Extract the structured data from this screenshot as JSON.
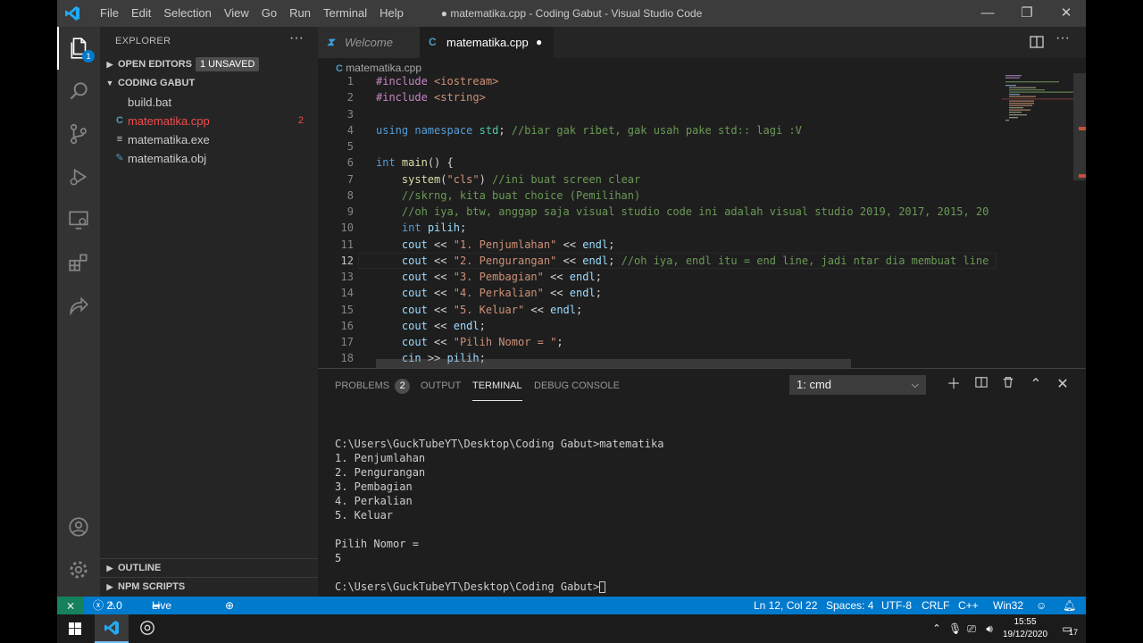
{
  "titlebar": {
    "menu": [
      "File",
      "Edit",
      "Selection",
      "View",
      "Go",
      "Run",
      "Terminal",
      "Help"
    ],
    "title": "● matematika.cpp - Coding Gabut - Visual Studio Code"
  },
  "activity": {
    "explorer_badge": "1"
  },
  "sidebar": {
    "title": "EXPLORER",
    "open_editors": "OPEN EDITORS",
    "unsaved": "1 UNSAVED",
    "folder": "CODING GABUT",
    "files": [
      {
        "icon": "build-file-icon",
        "name": "build.bat",
        "count": ""
      },
      {
        "icon": "cpp-file-icon",
        "name": "matematika.cpp",
        "count": "2"
      },
      {
        "icon": "exe-file-icon",
        "name": "matematika.exe",
        "count": ""
      },
      {
        "icon": "obj-file-icon",
        "name": "matematika.obj",
        "count": ""
      }
    ],
    "outline": "OUTLINE",
    "npm": "NPM SCRIPTS"
  },
  "editor": {
    "tabs": [
      {
        "label": "Welcome",
        "active": false
      },
      {
        "label": "matematika.cpp",
        "active": true
      }
    ],
    "breadcrumb": "matematika.cpp",
    "line_numbers": [
      "1",
      "2",
      "3",
      "4",
      "5",
      "6",
      "7",
      "8",
      "9",
      "10",
      "11",
      "12",
      "13",
      "14",
      "15",
      "16",
      "17",
      "18"
    ],
    "lines": [
      "#include <iostream>",
      "#include <string>",
      "",
      "using namespace std; //biar gak ribet, gak usah pake std:: lagi :V",
      "",
      "int main() {",
      "    system(\"cls\") //ini buat screen clear",
      "    //skrng, kita buat choice (Pemilihan)",
      "    //oh iya, btw, anggap saja visual studio code ini adalah visual studio 2019, 2017, 2015, 20",
      "    int pilih;",
      "    cout << \"1. Penjumlahan\" << endl;",
      "    cout << \"2. Pengurangan\" << endl; //oh iya, endl itu = end line, jadi ntar dia membuat line",
      "    cout << \"3. Pembagian\" << endl;",
      "    cout << \"4. Perkalian\" << endl;",
      "    cout << \"5. Keluar\" << endl;",
      "    cout << endl;",
      "    cout << \"Pilih Nomor = \";",
      "    cin >> pilih;"
    ]
  },
  "panel": {
    "tabs": [
      "PROBLEMS",
      "OUTPUT",
      "TERMINAL",
      "DEBUG CONSOLE"
    ],
    "problems_count": "2",
    "active_tab": "TERMINAL",
    "terminal_select": "1: cmd",
    "terminal_lines": [
      "C:\\Users\\GuckTubeYT\\Desktop\\Coding Gabut>matematika",
      "1. Penjumlahan",
      "2. Pengurangan",
      "3. Pembagian",
      "4. Perkalian",
      "5. Keluar",
      "",
      "Pilih Nomor =",
      "5",
      "",
      "C:\\Users\\GuckTubeYT\\Desktop\\Coding Gabut>"
    ]
  },
  "statusbar": {
    "errors": "2",
    "warnings": "0",
    "live_share": "Live Share",
    "position": "Ln 12, Col 22",
    "spaces": "Spaces: 4",
    "encoding": "UTF-8",
    "eol": "CRLF",
    "language": "C++",
    "platform": "Win32"
  },
  "taskbar": {
    "time": "15:55",
    "date": "19/12/2020",
    "notifications": "17"
  }
}
